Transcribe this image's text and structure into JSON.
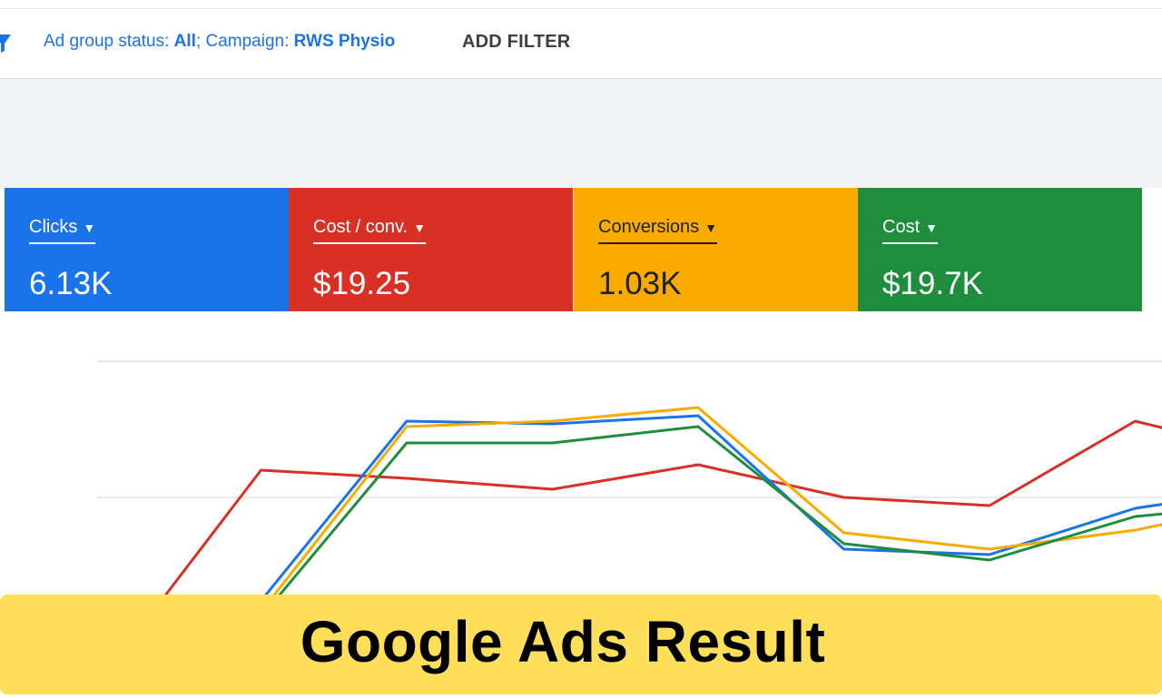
{
  "filter_bar": {
    "status_prefix": "Ad group status: ",
    "status_value": "All",
    "campaign_prefix": "; Campaign: ",
    "campaign_value": "RWS Physio",
    "add_filter_label": "ADD FILTER"
  },
  "metrics": [
    {
      "label": "Clicks",
      "value": "6.13K",
      "color": "#1a73e8",
      "icon": "caret-down-icon"
    },
    {
      "label": "Cost / conv.",
      "value": "$19.25",
      "color": "#d93025",
      "icon": "caret-down-icon"
    },
    {
      "label": "Conversions",
      "value": "1.03K",
      "color": "#f9ab00",
      "icon": "caret-down-icon"
    },
    {
      "label": "Cost",
      "value": "$19.7K",
      "color": "#1e8e3e",
      "icon": "caret-down-icon"
    }
  ],
  "banner": {
    "title": "Google Ads Result",
    "background": "#ffde59"
  },
  "chart_data": {
    "type": "line",
    "grid": true,
    "ylim": [
      0,
      100
    ],
    "x": [
      0,
      1,
      2,
      3,
      4,
      5,
      6,
      7,
      8
    ],
    "series": [
      {
        "color": "#d93025",
        "values": [
          -10,
          60,
          57,
          53,
          62,
          50,
          47,
          78,
          65
        ]
      },
      {
        "color": "#1a73e8",
        "values": [
          -22,
          12,
          78,
          77,
          80,
          31,
          29,
          46,
          54
        ]
      },
      {
        "color": "#f9ab00",
        "values": [
          -24,
          8,
          76,
          78,
          83,
          37,
          31,
          38,
          49
        ]
      },
      {
        "color": "#1e8e3e",
        "values": [
          -25,
          6,
          70,
          70,
          76,
          33,
          27,
          43,
          48
        ]
      }
    ]
  }
}
